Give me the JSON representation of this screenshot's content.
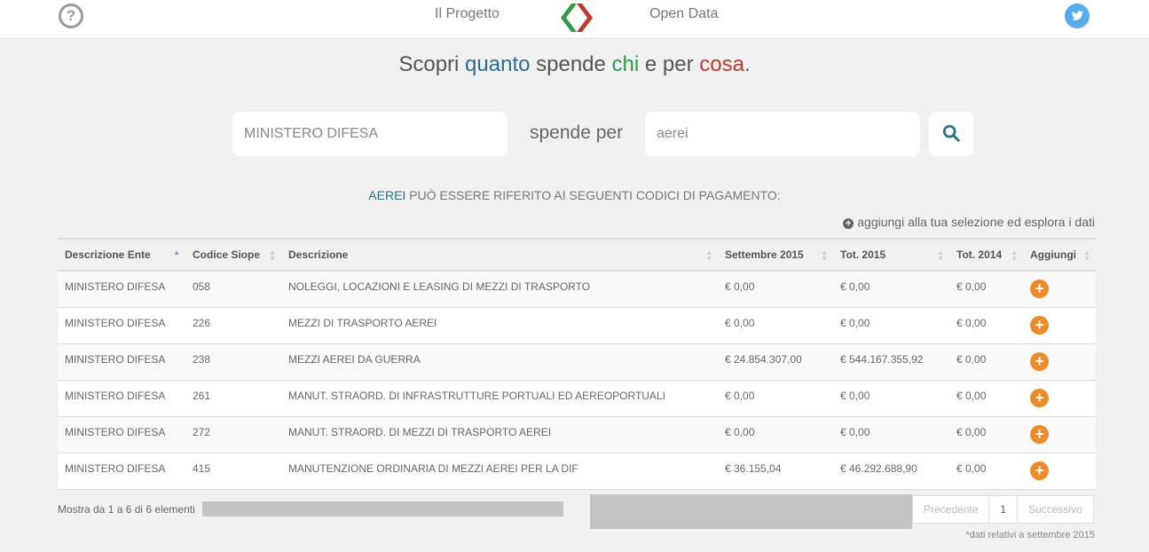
{
  "nav": {
    "project": "Il Progetto",
    "open_data": "Open Data"
  },
  "headline": {
    "w1": "Scopri ",
    "w2": "quanto",
    "w3": " spende ",
    "w4": "chi",
    "w5": " e per ",
    "w6": "cosa",
    "w7": "."
  },
  "search": {
    "ente_value": "MINISTERO DIFESA",
    "connector": "spende per",
    "cosa_value": "aerei"
  },
  "info": {
    "keyword": "AEREI",
    "rest": " PUÒ ESSERE RIFERITO AI SEGUENTI CODICI DI PAGAMENTO:"
  },
  "add_hint": "aggiungi alla tua selezione ed esplora i dati",
  "table": {
    "headers": [
      "Descrizione Ente",
      "Codice Siope",
      "Descrizione",
      "Settembre 2015",
      "Tot. 2015",
      "Tot. 2014",
      "Aggiungi"
    ],
    "rows": [
      [
        "MINISTERO DIFESA",
        "058",
        "NOLEGGI, LOCAZIONI E LEASING DI MEZZI DI TRASPORTO",
        "€ 0,00",
        "€ 0,00",
        "€ 0,00"
      ],
      [
        "MINISTERO DIFESA",
        "226",
        "MEZZI DI TRASPORTO AEREI",
        "€ 0,00",
        "€ 0,00",
        "€ 0,00"
      ],
      [
        "MINISTERO DIFESA",
        "238",
        "MEZZI AEREI DA GUERRA",
        "€ 24.854.307,00",
        "€ 544.167.355,92",
        "€ 0,00"
      ],
      [
        "MINISTERO DIFESA",
        "261",
        "MANUT. STRAORD. DI INFRASTRUTTURE PORTUALI ED AEREOPORTUALI",
        "€ 0,00",
        "€ 0,00",
        "€ 0,00"
      ],
      [
        "MINISTERO DIFESA",
        "272",
        "MANUT. STRAORD. DI MEZZI DI TRASPORTO AEREI",
        "€ 0,00",
        "€ 0,00",
        "€ 0,00"
      ],
      [
        "MINISTERO DIFESA",
        "415",
        "MANUTENZIONE ORDINARIA DI MEZZI AEREI PER LA DIF",
        "€ 36.155,04",
        "€ 46.292.688,90",
        "€ 0,00"
      ]
    ]
  },
  "footer": {
    "count": "Mostra da 1 a 6 di 6 elementi",
    "prev": "Precedente",
    "page": "1",
    "next": "Successivo",
    "note": "*dati relativi a settembre 2015"
  },
  "colors": {
    "quanto": "#2b6f8a",
    "chi": "#2e9a4a",
    "cosa": "#c0392b",
    "add_button": "#f08a24",
    "twitter": "#55acee"
  },
  "icons": [
    "help-icon",
    "logo-icon",
    "twitter-icon",
    "search-icon",
    "plus-circle-icon",
    "sort-icon"
  ]
}
